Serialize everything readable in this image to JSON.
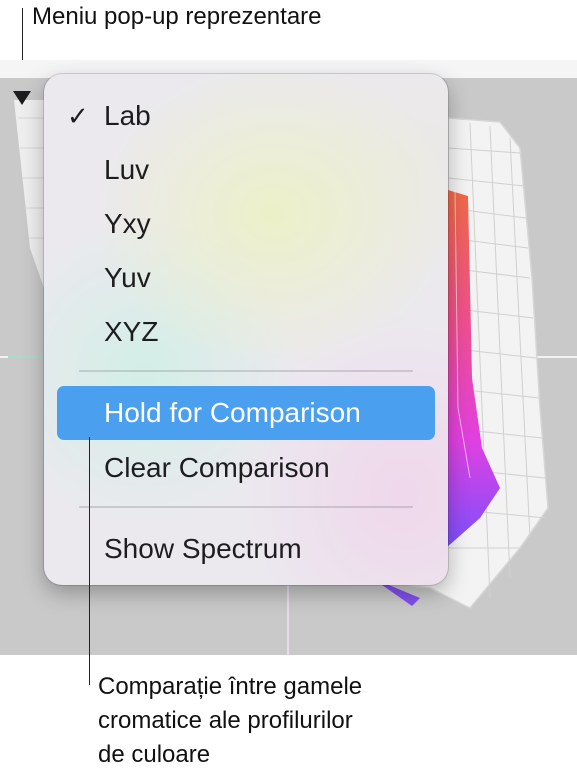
{
  "callouts": {
    "popup_label": "Meniu pop-up reprezentare",
    "comparison_label": "Comparație între gamele\ncromatice ale profilurilor\nde culoare"
  },
  "menu": {
    "check_mark": "✓",
    "items": [
      {
        "label": "Lab",
        "checked": true
      },
      {
        "label": "Luv"
      },
      {
        "label": "Yxy"
      },
      {
        "label": "Yuv"
      },
      {
        "label": "XYZ"
      },
      {
        "label": "Hold for Comparison",
        "highlighted": true
      },
      {
        "label": "Clear Comparison"
      },
      {
        "label": "Show Spectrum"
      }
    ]
  },
  "colors": {
    "highlight": "#4aa0ef",
    "graph_background": "#c9c9c9"
  },
  "icons": {
    "popup_arrow": "triangle-down-icon"
  }
}
